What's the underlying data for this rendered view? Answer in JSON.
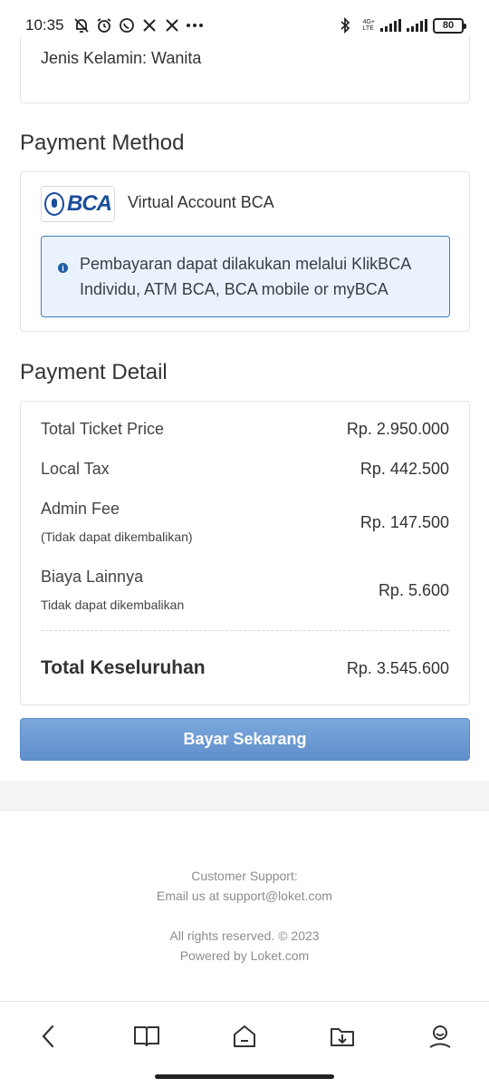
{
  "status_bar": {
    "time": "10:35",
    "network_label_top": "4G+",
    "network_label_bottom": "LTE",
    "battery": "80"
  },
  "attendee": {
    "gender_text": "Jenis Kelamin: Wanita"
  },
  "payment_method": {
    "title": "Payment Method",
    "bank_logo_text": "BCA",
    "method_name": "Virtual Account BCA",
    "info_text": "Pembayaran dapat dilakukan melalui KlikBCA Individu, ATM BCA, BCA mobile or myBCA"
  },
  "payment_detail": {
    "title": "Payment Detail",
    "rows": [
      {
        "label": "Total Ticket Price",
        "sub": "",
        "value": "Rp. 2.950.000"
      },
      {
        "label": "Local Tax",
        "sub": "",
        "value": "Rp. 442.500"
      },
      {
        "label": "Admin Fee",
        "sub": "(Tidak dapat dikembalikan)",
        "value": "Rp. 147.500"
      },
      {
        "label": "Biaya Lainnya",
        "sub": "Tidak dapat dikembalikan",
        "value": "Rp. 5.600"
      }
    ],
    "total_label": "Total Keseluruhan",
    "total_value": "Rp. 3.545.600"
  },
  "pay_button_label": "Bayar Sekarang",
  "footer": {
    "support_title": "Customer Support:",
    "support_email": "Email us at support@loket.com",
    "rights": "All rights reserved. © 2023",
    "powered": "Powered by Loket.com"
  },
  "bottom_nav": {
    "items": [
      "back-icon",
      "book-icon",
      "home-icon",
      "download-icon",
      "profile-icon"
    ]
  }
}
